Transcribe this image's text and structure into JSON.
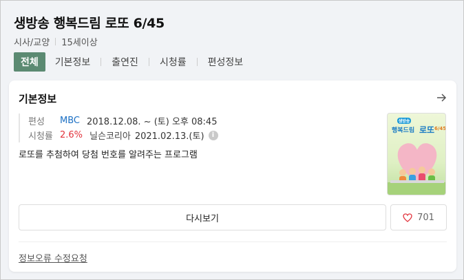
{
  "program": {
    "title": "생방송 행복드림 로또 6/45",
    "genre": "시사/교양",
    "rating": "15세이상"
  },
  "tabs": [
    {
      "label": "전체",
      "active": true
    },
    {
      "label": "기본정보",
      "active": false
    },
    {
      "label": "출연진",
      "active": false
    },
    {
      "label": "시청률",
      "active": false
    },
    {
      "label": "편성정보",
      "active": false
    }
  ],
  "basic_info": {
    "section_title": "기본정보",
    "schedule_label": "편성",
    "network": "MBC",
    "schedule": "2018.12.08. ~  (토) 오후 08:45",
    "rating_label": "시청률",
    "rating_value": "2.6%",
    "rating_source": "닐슨코리아",
    "rating_date": "2021.02.13.(토)",
    "info_icon": "i",
    "description": "로또를 추첨하여 당첨 번호를 알려주는 프로그램"
  },
  "poster": {
    "badge": "생방송",
    "line1": "행복드림",
    "line2": "로또",
    "line3": "6/45"
  },
  "actions": {
    "replay_label": "다시보기",
    "like_count": "701"
  },
  "report_link": "정보오류 수정요청",
  "colors": {
    "accent_green": "#5b8a72",
    "network_blue": "#1a6fc4",
    "rating_red": "#e2323b"
  }
}
